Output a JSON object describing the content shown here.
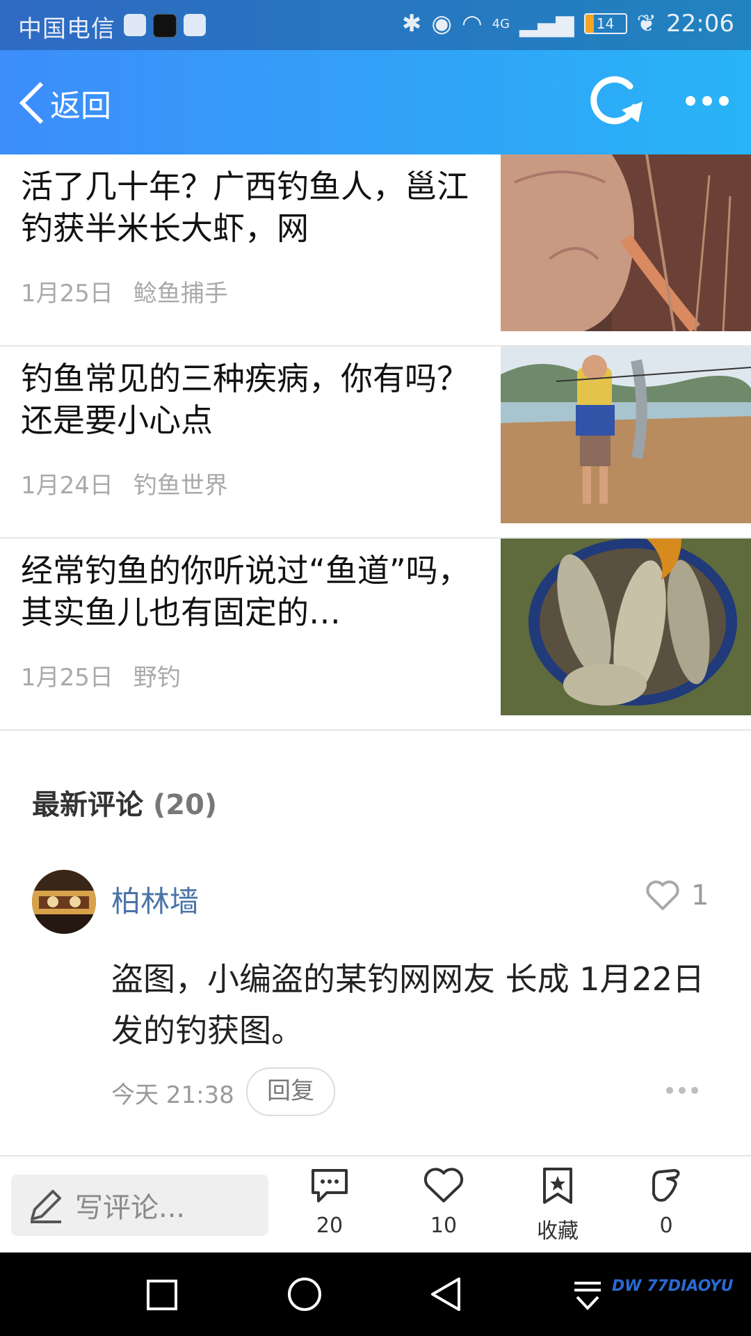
{
  "status_bar": {
    "carrier": "中国电信",
    "battery": "14",
    "time": "22:06",
    "network": "4G"
  },
  "nav": {
    "back_label": "返回"
  },
  "articles": [
    {
      "title": "活了几十年？广西钓鱼人，邕江钓获半米长大虾，网",
      "date": "1月25日",
      "source": "鲶鱼捕手"
    },
    {
      "title": "钓鱼常见的三种疾病，你有吗？还是要小心点",
      "date": "1月24日",
      "source": "钓鱼世界"
    },
    {
      "title": "经常钓鱼的你听说过“鱼道”吗，其实鱼儿也有固定的…",
      "date": "1月25日",
      "source": "野钓"
    }
  ],
  "comments_section": {
    "title": "最新评论",
    "count": "(20)"
  },
  "comment": {
    "user": "柏林墙",
    "likes": "1",
    "text": "盗图，小编盗的某钓网网友 长成 1月22日发的钓获图。",
    "time": "今天 21:38",
    "reply_label": "回复"
  },
  "action_bar": {
    "write_placeholder": "写评论...",
    "comment_count": "20",
    "like_count": "10",
    "favorite_label": "收藏",
    "share_count": "0"
  },
  "watermark": "DW 77DIAOYU",
  "colors": {
    "nav_gradient_start": "#3d8dfa",
    "nav_gradient_end": "#28b4f6",
    "username": "#4a74a8",
    "meta_gray": "#a9a9a9"
  }
}
